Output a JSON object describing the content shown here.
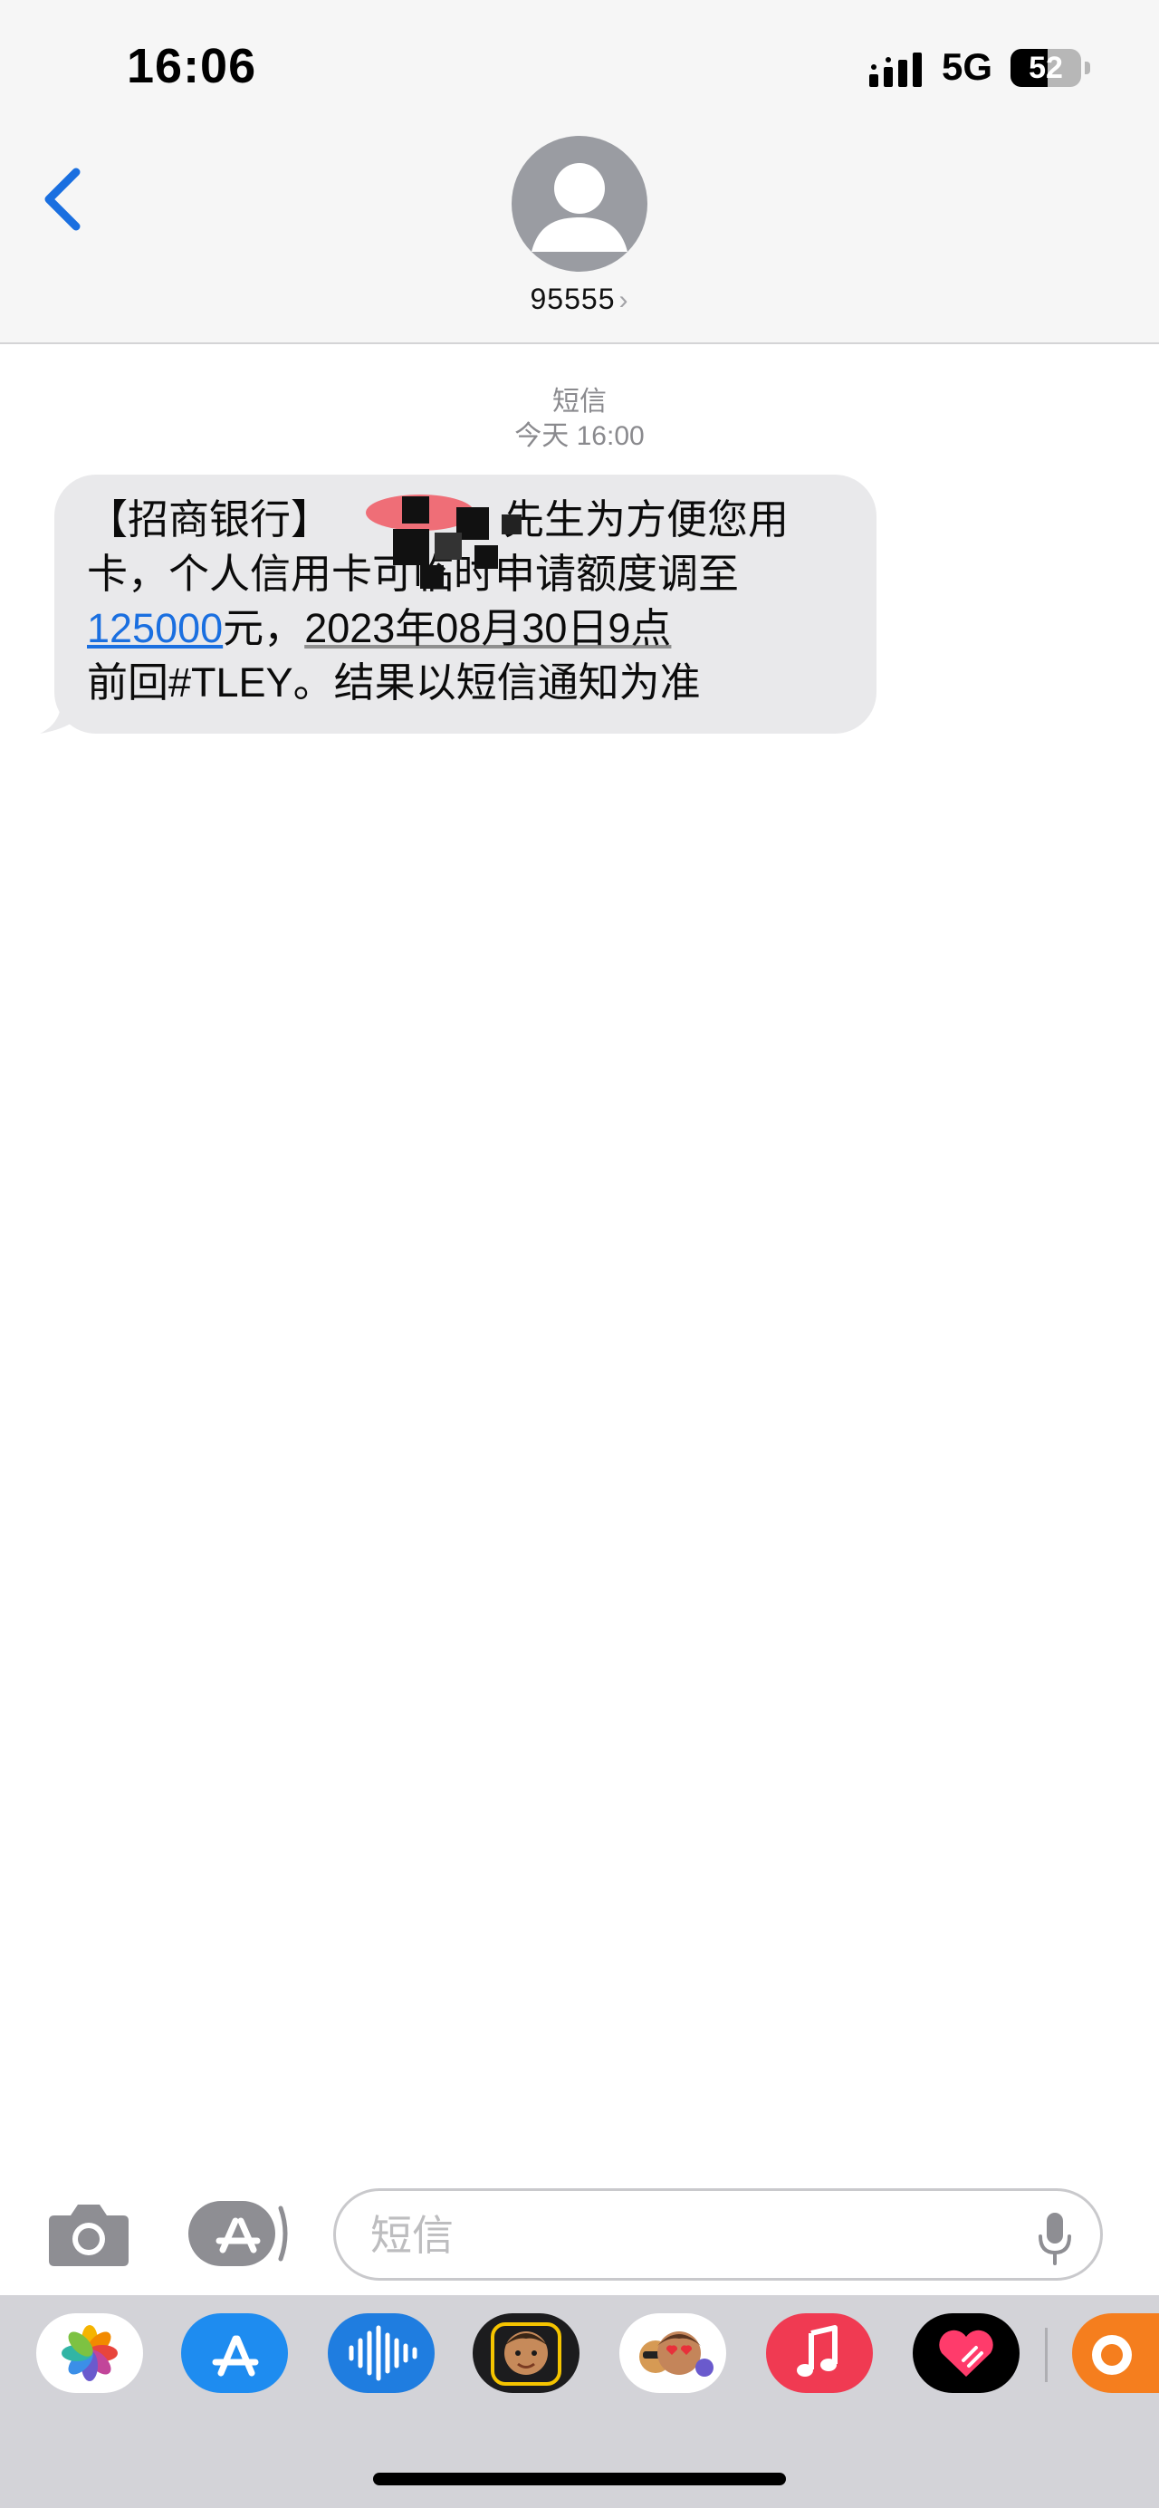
{
  "status_bar": {
    "time": "16:06",
    "network": "5G",
    "battery_percent": "52",
    "battery_level": 0.52
  },
  "header": {
    "contact_name": "95555",
    "chevron": "›",
    "back_icon": "chevron-left-icon"
  },
  "conversation": {
    "service_label": "短信",
    "timestamp": "今天 16:00",
    "message": {
      "line1": "【招商银行】",
      "line1_after_redaction": "先生为方便您用",
      "line2_a": "卡，个人信用卡可临时申请额度调至",
      "amount": "125000",
      "line3_mid": "元，",
      "date_text": "2023年08月30日9点",
      "line4": "前回#TLEY。结果以短信通知为准"
    }
  },
  "input_bar": {
    "placeholder": "短信",
    "camera_icon": "camera-icon",
    "apps_icon": "app-store-icon",
    "mic_icon": "microphone-icon"
  },
  "tray": {
    "apps": [
      "photos-icon",
      "app-store-icon",
      "audio-message-icon",
      "memoji-icon",
      "memoji-stickers-icon",
      "music-icon",
      "digital-touch-icon",
      "other-app-icon"
    ]
  },
  "colors": {
    "accent": "#1a6fe0",
    "bubble": "#e9e9eb",
    "header_bg": "#f6f6f6"
  }
}
